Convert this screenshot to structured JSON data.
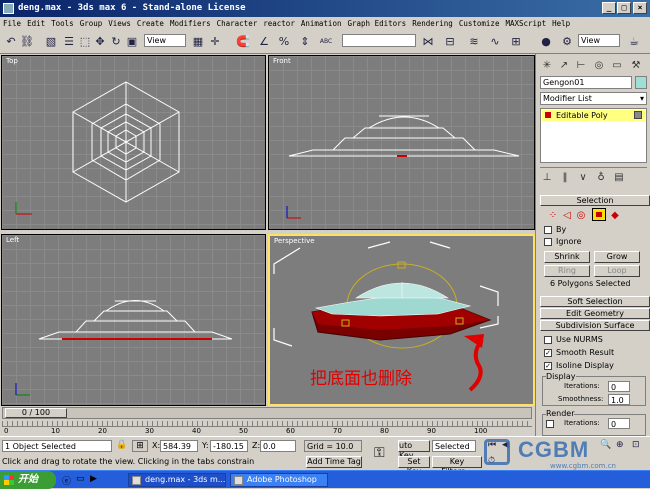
{
  "window": {
    "title": "deng.max - 3ds max 6 - Stand-alone License",
    "minimize": "_",
    "maximize": "□",
    "close": "×"
  },
  "menu": [
    "File",
    "Edit",
    "Tools",
    "Group",
    "Views",
    "Create",
    "Modifiers",
    "Character",
    "reactor",
    "Animation",
    "Graph Editors",
    "Rendering",
    "Customize",
    "MAXScript",
    "Help"
  ],
  "toolbar": {
    "view_dropdown_1": "View",
    "view_dropdown_2": "View",
    "snap_dropdown": "",
    "abc_label": "ABC"
  },
  "viewports": {
    "top": "Top",
    "front": "Front",
    "left": "Left",
    "perspective": "Perspective"
  },
  "annotation": "把底面也删除",
  "command_panel": {
    "object_name": "Gengon01",
    "modifier_list": "Modifier List",
    "stack_item": "Editable Poly",
    "selection_header": "Selection",
    "by_label": "By",
    "ignore_label": "Ignore",
    "shrink": "Shrink",
    "grow": "Grow",
    "ring": "Ring",
    "loop": "Loop",
    "selected_info": "6 Polygons Selected",
    "soft_selection": "Soft Selection",
    "edit_geometry": "Edit Geometry",
    "subdivision_surface": "Subdivision Surface",
    "use_nurms": "Use NURMS",
    "smooth_result": "Smooth Result",
    "isoline_display": "Isoline Display",
    "display_group": "Display",
    "iterations_label": "Iterations:",
    "iterations_value": "0",
    "smoothness_label": "Smoothness:",
    "smoothness_value": "1.0",
    "render_group": "Render",
    "render_iterations_label": "Iterations:",
    "render_iterations_value": "0"
  },
  "timeline": {
    "frame_readout": "0 / 100",
    "ticks": [
      "0",
      "10",
      "20",
      "30",
      "40",
      "50",
      "60",
      "70",
      "80",
      "90",
      "100"
    ]
  },
  "status": {
    "selection_info": "1 Object Selected",
    "prompt": "Click and drag to rotate the view.  Clicking in the tabs constrain",
    "x_label": "X:",
    "x_value": "584.39",
    "y_label": "Y:",
    "y_value": "-180.15",
    "z_label": "Z:",
    "z_value": "0.0",
    "grid": "Grid = 10.0",
    "add_time_tag": "Add Time Tag",
    "auto_key": "uto Key",
    "set_key": "Set Key",
    "selected_dropdown": "Selected",
    "key_filters": "Key Filters..."
  },
  "watermark": {
    "brand": "CGBM",
    "url": "www.cgbm.com.cn"
  },
  "taskbar": {
    "start": "开始",
    "tasks": [
      "deng.max - 3ds m...",
      "Adobe Photoshop"
    ]
  }
}
